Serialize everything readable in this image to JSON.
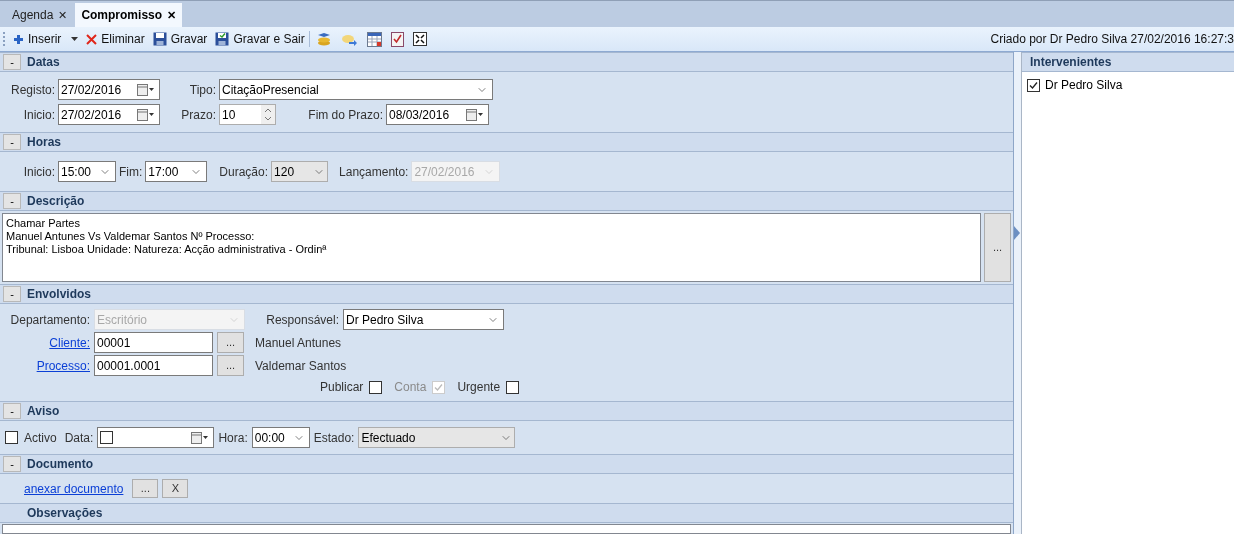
{
  "tabs": [
    {
      "label": "Agenda",
      "close": "✕",
      "selected": false
    },
    {
      "label": "Compromisso",
      "close": "✕",
      "selected": true
    }
  ],
  "toolbar": {
    "buttons": [
      {
        "kind": "insert",
        "label": "Inserir",
        "dropdown": true
      },
      {
        "kind": "delete",
        "label": "Eliminar",
        "dropdown": false
      },
      {
        "kind": "save",
        "label": "Gravar",
        "dropdown": false
      },
      {
        "kind": "save-exit",
        "label": "Gravar e Sair",
        "dropdown": false
      }
    ],
    "status": "Criado por Dr Pedro Silva 27/02/2016 16:27:3"
  },
  "datas": {
    "collapse": "-",
    "title": "Datas",
    "registo": {
      "label": "Registo:",
      "kind": "date",
      "value": "27/02/2016",
      "disabled": false
    },
    "tipo": {
      "label": "Tipo:",
      "kind": "combo",
      "value": "CitaçãoPresencial",
      "disabled": false
    },
    "inicio": {
      "label": "Inicio:",
      "kind": "date",
      "value": "27/02/2016",
      "disabled": false
    },
    "prazo": {
      "label": "Prazo:",
      "kind": "spin",
      "value": "10",
      "disabled": false
    },
    "fim_prazo": {
      "label": "Fim do Prazo:",
      "kind": "date",
      "value": "08/03/2016",
      "disabled": false
    }
  },
  "horas": {
    "collapse": "-",
    "title": "Horas",
    "inicio": {
      "label": "Inicio:",
      "kind": "combo",
      "value": "15:00",
      "disabled": false
    },
    "fim": {
      "label": "Fim:",
      "kind": "combo",
      "value": "17:00",
      "disabled": false
    },
    "duracao": {
      "label": "Duração:",
      "kind": "dropdown",
      "value": "120",
      "disabled": false
    },
    "lancamento": {
      "label": "Lançamento:",
      "kind": "combo",
      "value": "27/02/2016",
      "disabled": true
    }
  },
  "descricao": {
    "collapse": "-",
    "title": "Descrição",
    "lines": [
      "Chamar Partes",
      "Manuel Antunes Vs Valdemar Santos Nº Processo:",
      "Tribunal: Lisboa Unidade:  Natureza: Acção administrativa - Ordinª"
    ],
    "button": "..."
  },
  "envolvidos": {
    "collapse": "-",
    "title": "Envolvidos",
    "departamento": {
      "label": "Departamento:",
      "kind": "combo",
      "value": "Escritório",
      "disabled": true
    },
    "responsavel": {
      "label": "Responsável:",
      "kind": "combo",
      "value": "Dr Pedro Silva",
      "disabled": false
    },
    "cliente": {
      "label": "Cliente:",
      "kind": "text",
      "value": "00001",
      "disabled": false,
      "button": "...",
      "name": "Manuel Antunes"
    },
    "processo": {
      "label": "Processo:",
      "kind": "text",
      "value": "00001.0001",
      "disabled": false,
      "button": "...",
      "name": "Valdemar Santos"
    },
    "flags": [
      {
        "label": "Publicar",
        "checked": false,
        "disabled": false
      },
      {
        "label": "Conta",
        "checked": true,
        "disabled": true
      },
      {
        "label": "Urgente",
        "checked": false,
        "disabled": false
      }
    ]
  },
  "aviso": {
    "collapse": "-",
    "title": "Aviso",
    "activo": {
      "label": "Activo",
      "checked": false
    },
    "data": {
      "label": "Data:",
      "kind": "date",
      "checked": false,
      "disabled": false
    },
    "hora": {
      "label": "Hora:",
      "kind": "combo",
      "value": "00:00",
      "disabled": false
    },
    "estado": {
      "label": "Estado:",
      "kind": "dropdown",
      "value": "Efectuado",
      "disabled": false
    }
  },
  "documento": {
    "collapse": "-",
    "title": "Documento",
    "link": "anexar documento",
    "buttons": [
      "...",
      "X"
    ]
  },
  "observacoes": {
    "title": "Observações"
  },
  "intervenientes": {
    "title": "Intervenientes",
    "items": [
      {
        "label": "Dr Pedro Silva",
        "checked": true
      }
    ]
  }
}
